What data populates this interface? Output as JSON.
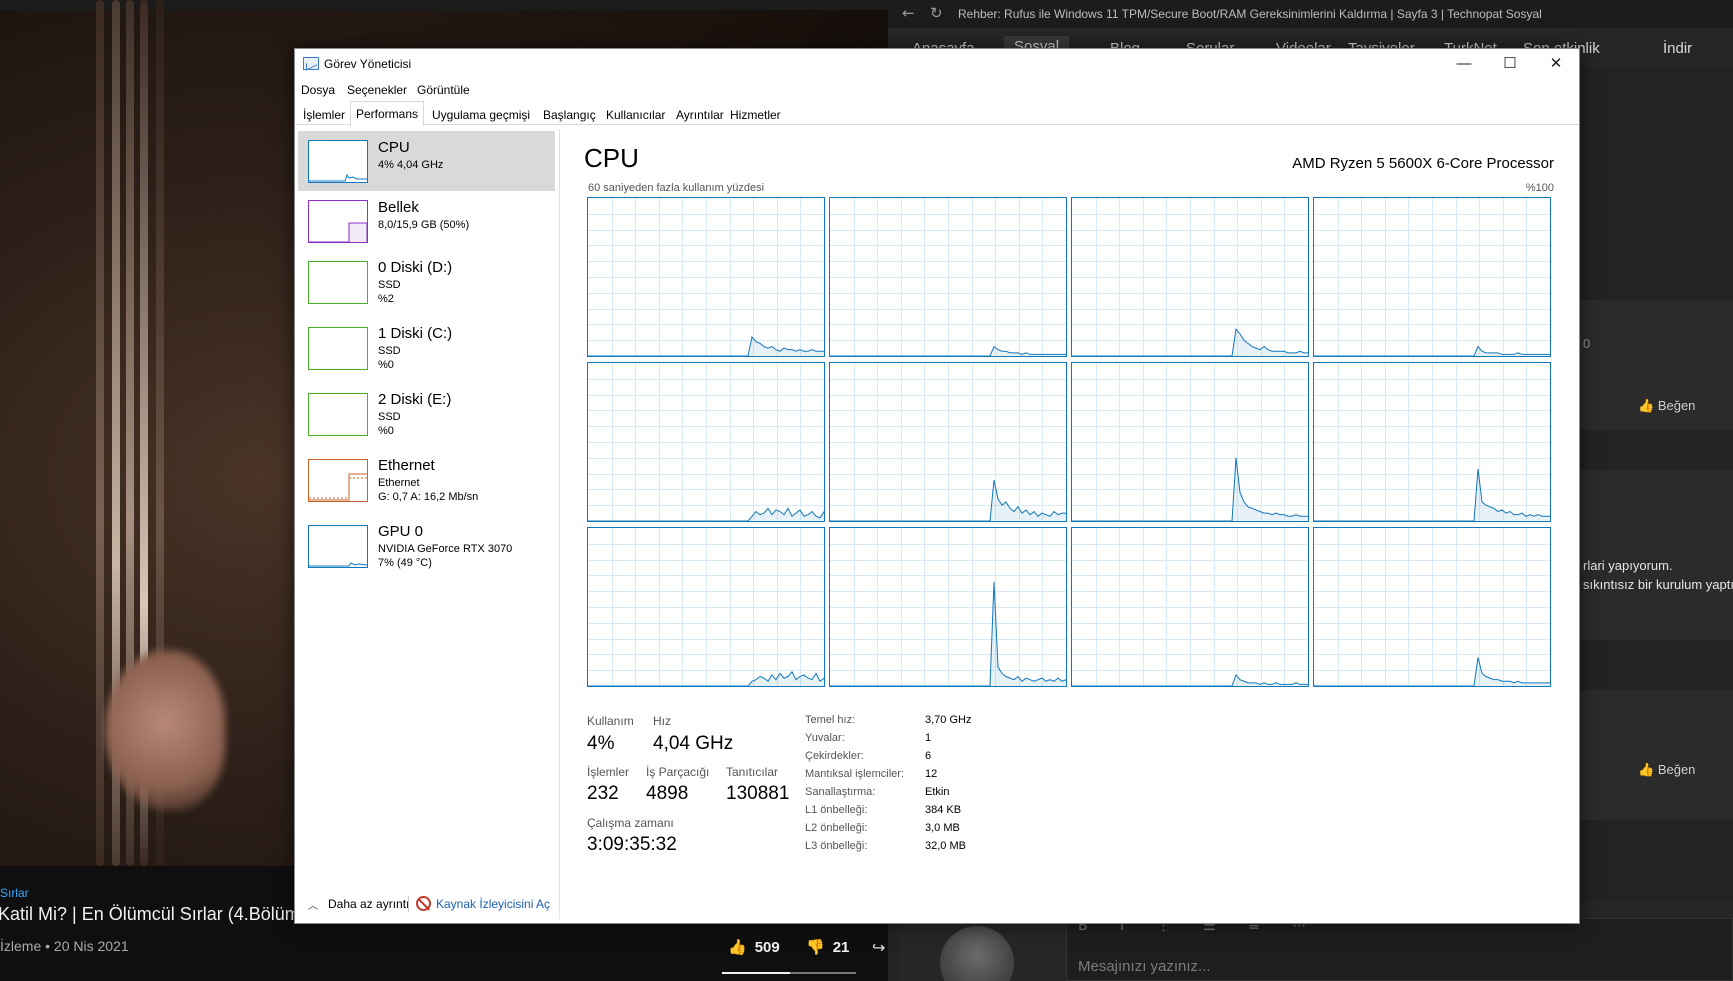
{
  "video": {
    "channel": "Sırlar",
    "title": "Katil Mi? | En Ölümcül Sırlar (4.Bölüm)",
    "views": "İzleme • 20 Nis 2021",
    "likes": "509",
    "dislikes": "21"
  },
  "browser": {
    "url": "Rehber: Rufus ile Windows 11 TPM/Secure Boot/RAM Gereksinimlerini Kaldırma | Sayfa 3 | Technopat Sosyal",
    "nav": [
      "Anasayfa",
      "Sosyal",
      "Blog",
      "Sorular",
      "Videolar",
      "Tavsiyeler",
      "TurkNet",
      "Son etkinlik",
      "İndir"
    ],
    "like_label": "Beğen",
    "side_text_1": "rlari yapıyorum.",
    "side_text_2": "sıkıntısız bir kurulum yaptı",
    "side_zero": "0",
    "composer_placeholder": "Mesajınızı yazınız..."
  },
  "taskmanager": {
    "window_title": "Görev Yöneticisi",
    "menu": [
      "Dosya",
      "Seçenekler",
      "Görüntüle"
    ],
    "tabs": [
      "İşlemler",
      "Performans",
      "Uygulama geçmişi",
      "Başlangıç",
      "Kullanıcılar",
      "Ayrıntılar",
      "Hizmetler"
    ],
    "selected_tab": "Performans",
    "devices": [
      {
        "name": "CPU",
        "line1": "4% 4,04 GHz",
        "line2": "",
        "color": "#1177bb"
      },
      {
        "name": "Bellek",
        "line1": "8,0/15,9 GB (50%)",
        "line2": "",
        "color": "#8b2fc9"
      },
      {
        "name": "0 Diski (D:)",
        "line1": "SSD",
        "line2": "%2",
        "color": "#4caf28"
      },
      {
        "name": "1 Diski (C:)",
        "line1": "SSD",
        "line2": "%0",
        "color": "#4caf28"
      },
      {
        "name": "2 Diski (E:)",
        "line1": "SSD",
        "line2": "%0",
        "color": "#4caf28"
      },
      {
        "name": "Ethernet",
        "line1": "Ethernet",
        "line2": "G: 0,7 A: 16,2 Mb/sn",
        "color": "#c8632a"
      },
      {
        "name": "GPU 0",
        "line1": "NVIDIA GeForce RTX 3070",
        "line2": "7% (49 °C)",
        "color": "#1177bb"
      }
    ],
    "cpu": {
      "heading": "CPU",
      "model": "AMD Ryzen 5 5600X 6-Core Processor",
      "graph_caption": "60 saniyeden fazla kullanım yüzdesi",
      "graph_max": "%100",
      "utilization_label": "Kullanım",
      "utilization": "4%",
      "speed_label": "Hız",
      "speed": "4,04 GHz",
      "processes_label": "İşlemler",
      "processes": "232",
      "threads_label": "İş Parçacığı",
      "threads": "4898",
      "handles_label": "Tanıtıcılar",
      "handles": "130881",
      "uptime_label": "Çalışma zamanı",
      "uptime": "3:09:35:32",
      "specs": [
        {
          "label": "Temel hız:",
          "value": "3,70 GHz"
        },
        {
          "label": "Yuvalar:",
          "value": "1"
        },
        {
          "label": "Çekirdekler:",
          "value": "6"
        },
        {
          "label": "Mantıksal işlemciler:",
          "value": "12"
        },
        {
          "label": "Sanallaştırma:",
          "value": "Etkin"
        },
        {
          "label": "L1 önbelleği:",
          "value": "384 KB"
        },
        {
          "label": "L2 önbelleği:",
          "value": "3,0 MB"
        },
        {
          "label": "L3 önbelleği:",
          "value": "32,0 MB"
        }
      ],
      "core_series": [
        [
          0,
          0,
          0,
          0,
          0,
          0,
          0,
          0,
          0,
          0,
          0,
          0,
          0,
          0,
          0,
          0,
          0,
          0,
          0,
          0,
          0,
          0,
          0,
          0,
          0,
          0,
          0,
          0,
          0,
          0,
          0,
          0,
          0,
          0,
          0,
          0,
          0,
          0,
          0,
          0,
          0,
          12,
          9,
          8,
          6,
          5,
          6,
          4,
          3,
          5,
          4,
          4,
          3,
          4,
          3,
          3,
          4,
          3,
          3,
          3
        ],
        [
          0,
          0,
          0,
          0,
          0,
          0,
          0,
          0,
          0,
          0,
          0,
          0,
          0,
          0,
          0,
          0,
          0,
          0,
          0,
          0,
          0,
          0,
          0,
          0,
          0,
          0,
          0,
          0,
          0,
          0,
          0,
          0,
          0,
          0,
          0,
          0,
          0,
          0,
          0,
          0,
          0,
          6,
          4,
          3,
          3,
          2,
          2,
          2,
          1,
          2,
          1,
          1,
          1,
          1,
          1,
          1,
          1,
          1,
          1,
          1
        ],
        [
          0,
          0,
          0,
          0,
          0,
          0,
          0,
          0,
          0,
          0,
          0,
          0,
          0,
          0,
          0,
          0,
          0,
          0,
          0,
          0,
          0,
          0,
          0,
          0,
          0,
          0,
          0,
          0,
          0,
          0,
          0,
          0,
          0,
          0,
          0,
          0,
          0,
          0,
          0,
          0,
          0,
          17,
          14,
          10,
          8,
          6,
          5,
          4,
          6,
          4,
          3,
          3,
          3,
          3,
          2,
          2,
          2,
          3,
          2,
          2
        ],
        [
          0,
          0,
          0,
          0,
          0,
          0,
          0,
          0,
          0,
          0,
          0,
          0,
          0,
          0,
          0,
          0,
          0,
          0,
          0,
          0,
          0,
          0,
          0,
          0,
          0,
          0,
          0,
          0,
          0,
          0,
          0,
          0,
          0,
          0,
          0,
          0,
          0,
          0,
          0,
          0,
          0,
          6,
          3,
          2,
          2,
          2,
          2,
          1,
          1,
          1,
          1,
          2,
          1,
          1,
          1,
          1,
          1,
          1,
          1,
          1
        ],
        [
          0,
          0,
          0,
          0,
          0,
          0,
          0,
          0,
          0,
          0,
          0,
          0,
          0,
          0,
          0,
          0,
          0,
          0,
          0,
          0,
          0,
          0,
          0,
          0,
          0,
          0,
          0,
          0,
          0,
          0,
          0,
          0,
          0,
          0,
          0,
          0,
          0,
          0,
          0,
          0,
          0,
          3,
          6,
          4,
          5,
          8,
          4,
          7,
          6,
          4,
          8,
          3,
          5,
          7,
          3,
          4,
          6,
          3,
          2,
          6
        ],
        [
          0,
          0,
          0,
          0,
          0,
          0,
          0,
          0,
          0,
          0,
          0,
          0,
          0,
          0,
          0,
          0,
          0,
          0,
          0,
          0,
          0,
          0,
          0,
          0,
          0,
          0,
          0,
          0,
          0,
          0,
          0,
          0,
          0,
          0,
          0,
          0,
          0,
          0,
          0,
          0,
          0,
          26,
          14,
          10,
          12,
          8,
          6,
          9,
          5,
          7,
          4,
          6,
          3,
          5,
          4,
          3,
          6,
          4,
          5,
          5
        ],
        [
          0,
          0,
          0,
          0,
          0,
          0,
          0,
          0,
          0,
          0,
          0,
          0,
          0,
          0,
          0,
          0,
          0,
          0,
          0,
          0,
          0,
          0,
          0,
          0,
          0,
          0,
          0,
          0,
          0,
          0,
          0,
          0,
          0,
          0,
          0,
          0,
          0,
          0,
          0,
          0,
          0,
          40,
          18,
          12,
          9,
          8,
          7,
          6,
          5,
          5,
          4,
          5,
          4,
          4,
          3,
          3,
          4,
          3,
          3,
          3
        ],
        [
          0,
          0,
          0,
          0,
          0,
          0,
          0,
          0,
          0,
          0,
          0,
          0,
          0,
          0,
          0,
          0,
          0,
          0,
          0,
          0,
          0,
          0,
          0,
          0,
          0,
          0,
          0,
          0,
          0,
          0,
          0,
          0,
          0,
          0,
          0,
          0,
          0,
          0,
          0,
          0,
          0,
          33,
          12,
          10,
          9,
          8,
          6,
          7,
          5,
          6,
          4,
          4,
          5,
          3,
          4,
          3,
          4,
          3,
          3,
          3
        ],
        [
          0,
          0,
          0,
          0,
          0,
          0,
          0,
          0,
          0,
          0,
          0,
          0,
          0,
          0,
          0,
          0,
          0,
          0,
          0,
          0,
          0,
          0,
          0,
          0,
          0,
          0,
          0,
          0,
          0,
          0,
          0,
          0,
          0,
          0,
          0,
          0,
          0,
          0,
          0,
          0,
          0,
          3,
          4,
          6,
          5,
          3,
          7,
          4,
          8,
          5,
          6,
          9,
          4,
          6,
          7,
          5,
          4,
          8,
          3,
          5
        ],
        [
          0,
          0,
          0,
          0,
          0,
          0,
          0,
          0,
          0,
          0,
          0,
          0,
          0,
          0,
          0,
          0,
          0,
          0,
          0,
          0,
          0,
          0,
          0,
          0,
          0,
          0,
          0,
          0,
          0,
          0,
          0,
          0,
          0,
          0,
          0,
          0,
          0,
          0,
          0,
          0,
          0,
          66,
          12,
          8,
          6,
          5,
          4,
          6,
          3,
          5,
          4,
          3,
          4,
          5,
          3,
          4,
          3,
          5,
          3,
          4
        ],
        [
          0,
          0,
          0,
          0,
          0,
          0,
          0,
          0,
          0,
          0,
          0,
          0,
          0,
          0,
          0,
          0,
          0,
          0,
          0,
          0,
          0,
          0,
          0,
          0,
          0,
          0,
          0,
          0,
          0,
          0,
          0,
          0,
          0,
          0,
          0,
          0,
          0,
          0,
          0,
          0,
          0,
          7,
          4,
          3,
          2,
          2,
          2,
          1,
          2,
          1,
          1,
          2,
          1,
          1,
          1,
          1,
          2,
          1,
          1,
          1
        ],
        [
          0,
          0,
          0,
          0,
          0,
          0,
          0,
          0,
          0,
          0,
          0,
          0,
          0,
          0,
          0,
          0,
          0,
          0,
          0,
          0,
          0,
          0,
          0,
          0,
          0,
          0,
          0,
          0,
          0,
          0,
          0,
          0,
          0,
          0,
          0,
          0,
          0,
          0,
          0,
          0,
          0,
          18,
          8,
          6,
          5,
          4,
          4,
          3,
          3,
          3,
          2,
          3,
          2,
          2,
          2,
          2,
          2,
          2,
          2,
          2
        ]
      ]
    },
    "footer": {
      "fewer_details": "Daha az ayrıntı",
      "resource_monitor": "Kaynak İzleyicisini Aç"
    }
  }
}
